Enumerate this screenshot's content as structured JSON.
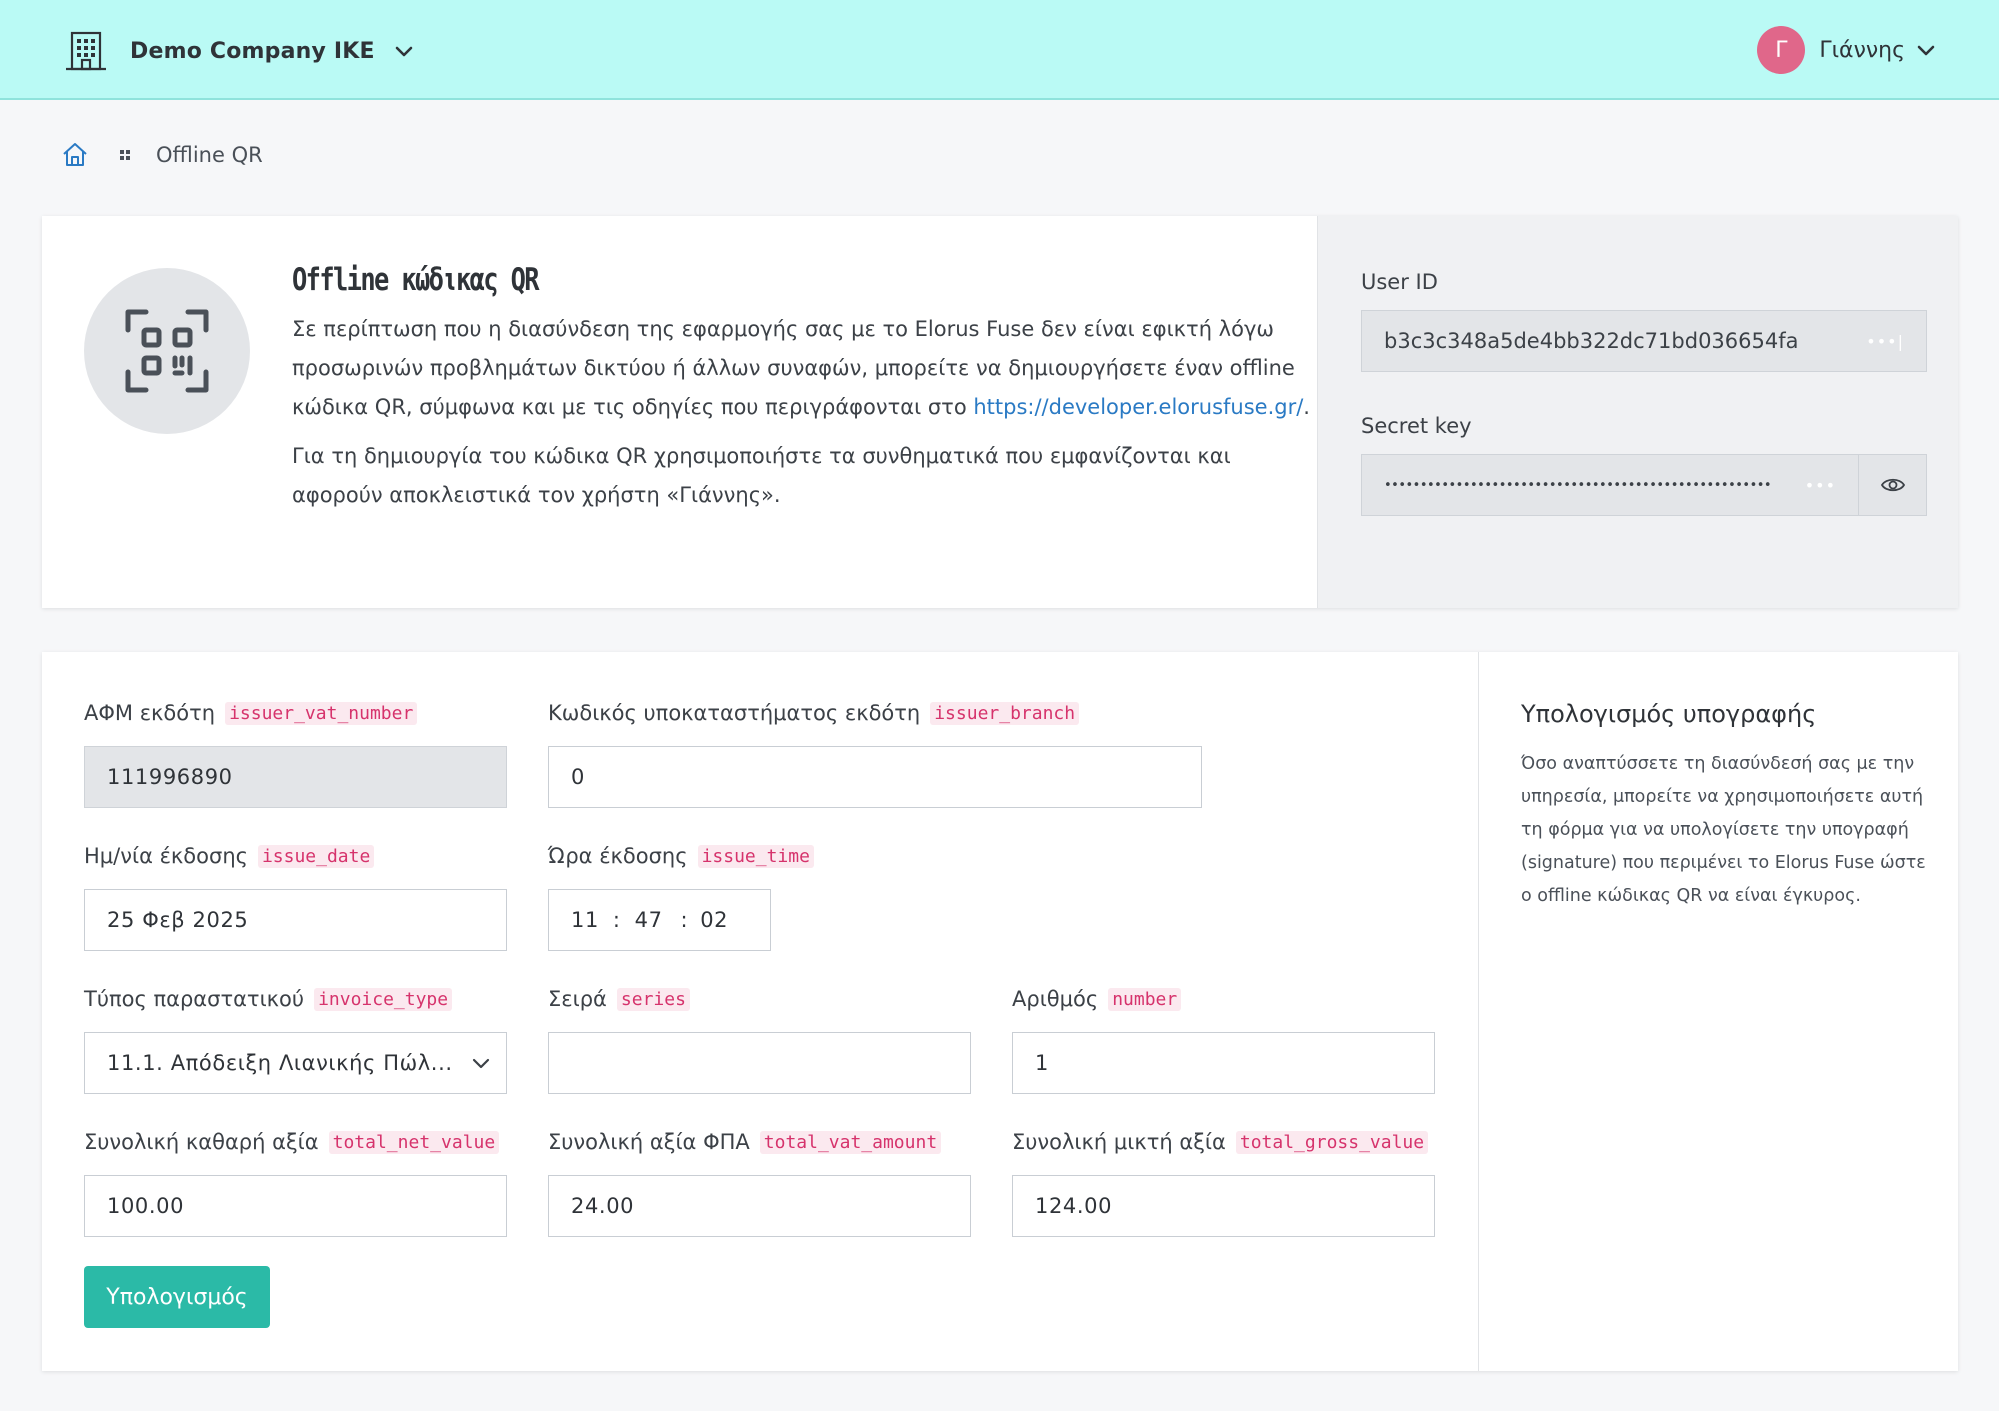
{
  "header": {
    "company_name": "Demo Company IKE",
    "user_initial": "Γ",
    "user_name": "Γιάννης",
    "avatar_color": "#e0678a",
    "bar_color": "#bafaf5"
  },
  "breadcrumb": {
    "current": "Offline QR"
  },
  "info": {
    "title": "Offline κώδικας QR",
    "paragraph1_text": "Σε περίπτωση που η διασύνδεση της εφαρμογής σας με το Elorus Fuse δεν είναι εφικτή λόγω προσωρινών προβλημάτων δικτύου ή άλλων συναφών, μπορείτε να δημιουργήσετε έναν offline κώδικα QR, σύμφωνα και με τις οδηγίες που περιγράφονται στο ",
    "paragraph1_link": "https://developer.elorusfuse.gr/",
    "paragraph1_end": ".",
    "paragraph2": "Για τη δημιουργία του κώδικα QR χρησιμοποιήστε τα συνθηματικά που εμφανίζονται και αφορούν αποκλειστικά τον χρήστη «Γιάννης»."
  },
  "credentials": {
    "user_id_label": "User ID",
    "user_id_value": "b3c3c348a5de4bb322dc71bd036654fa",
    "secret_key_label": "Secret key",
    "secret_key_value": "••••••••••••••••••••••••••••••••••••••••••••••••••••••"
  },
  "form": {
    "issuer_vat": {
      "label": "ΑΦΜ εκδότη",
      "code": "issuer_vat_number",
      "value": "111996890"
    },
    "issuer_branch": {
      "label": "Κωδικός υποκαταστήματος εκδότη",
      "code": "issuer_branch",
      "value": "0"
    },
    "issue_date": {
      "label": "Ημ/νία έκδοσης",
      "code": "issue_date",
      "value": "25 Φεβ 2025"
    },
    "issue_time": {
      "label": "Ώρα έκδοσης",
      "code": "issue_time",
      "hours": "11",
      "minutes": "47",
      "seconds": "02"
    },
    "invoice_type": {
      "label": "Τύπος παραστατικού",
      "code": "invoice_type",
      "value": "11.1. Απόδειξη Λιανικής Πώλ..."
    },
    "series": {
      "label": "Σειρά",
      "code": "series",
      "value": ""
    },
    "number": {
      "label": "Αριθμός",
      "code": "number",
      "value": "1"
    },
    "total_net": {
      "label": "Συνολική καθαρή αξία",
      "code": "total_net_value",
      "value": "100.00"
    },
    "total_vat": {
      "label": "Συνολική αξία ΦΠΑ",
      "code": "total_vat_amount",
      "value": "24.00"
    },
    "total_gross": {
      "label": "Συνολική μικτή αξία",
      "code": "total_gross_value",
      "value": "124.00"
    },
    "submit_label": "Υπολογισμός",
    "submit_color": "#2bbaa7"
  },
  "side_panel": {
    "title": "Υπολογισμός υπογραφής",
    "text": "Όσο αναπτύσσετε τη διασύνδεσή σας με την υπηρεσία, μπορείτε να χρησιμοποιήσετε αυτή τη φόρμα για να υπολογίσετε την υπογραφή (signature) που περιμένει το Elorus Fuse ώστε ο offline κώδικας QR να είναι έγκυρος."
  },
  "icons": {
    "company": "building-icon",
    "dropdown": "chevron-down-icon",
    "home": "home-icon",
    "breadcrumb_separator": "dots-icon",
    "qr": "qr-scan-icon",
    "reveal": "eye-icon"
  }
}
